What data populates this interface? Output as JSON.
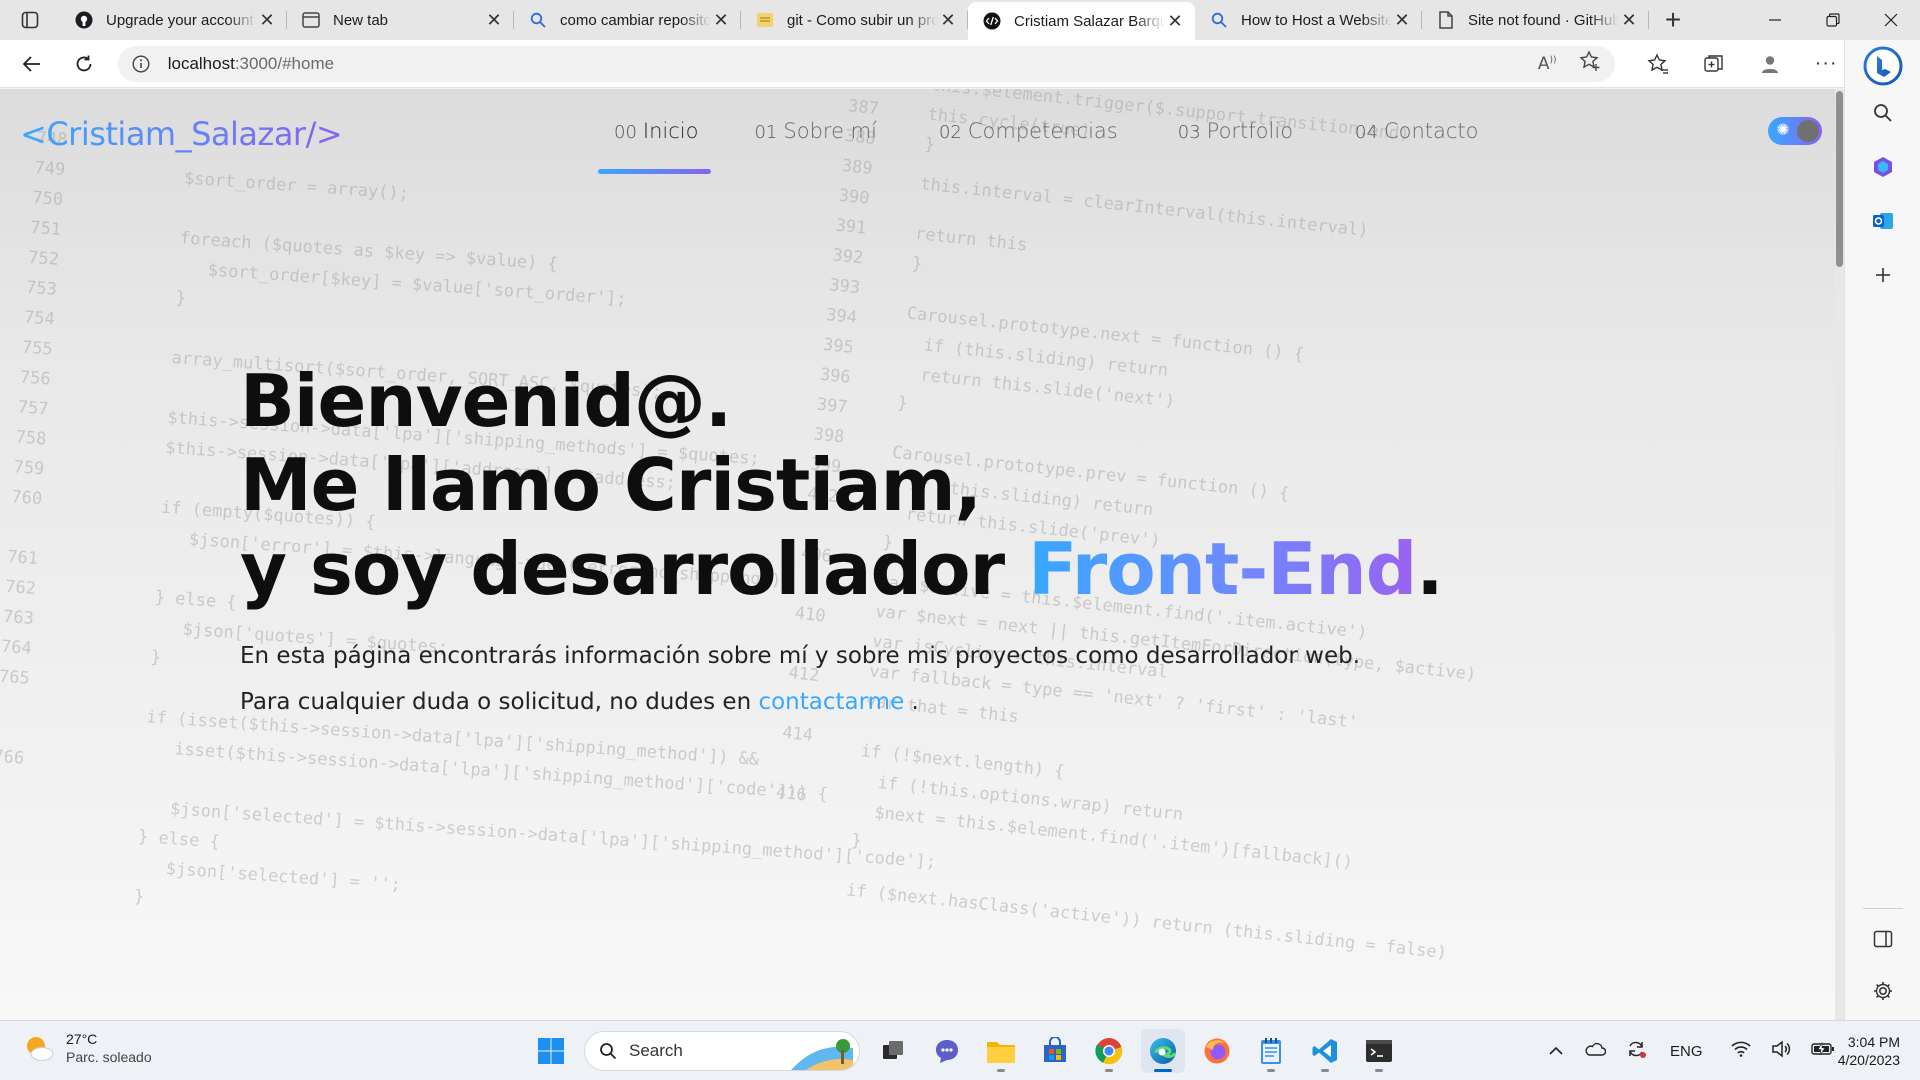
{
  "browser": {
    "tabs": [
      {
        "title": "Upgrade your account",
        "icon": "github-icon",
        "active": false
      },
      {
        "title": "New tab",
        "icon": "newtab-page-icon",
        "active": false
      },
      {
        "title": "como cambiar repositorio",
        "icon": "search-icon",
        "active": false
      },
      {
        "title": "git - Como subir un proyecto",
        "icon": "stackoverflow-icon",
        "active": false
      },
      {
        "title": "Cristiam Salazar Barquero",
        "icon": "site-logo-icon",
        "active": true
      },
      {
        "title": "How to Host a Website",
        "icon": "search-icon",
        "active": false
      },
      {
        "title": "Site not found · GitHub",
        "icon": "page-icon",
        "active": false
      }
    ],
    "address": {
      "host": "localhost",
      "path": ":3000/#home"
    }
  },
  "site": {
    "logo": "<Cristiam_Salazar/>",
    "nav": [
      {
        "num": "00",
        "label": "Inicio",
        "active": true
      },
      {
        "num": "01",
        "label": "Sobre mí",
        "active": false
      },
      {
        "num": "02",
        "label": "Competencias",
        "active": false
      },
      {
        "num": "03",
        "label": "Portfolio",
        "active": false
      },
      {
        "num": "04",
        "label": "Contacto",
        "active": false
      }
    ],
    "theme_toggle": {
      "icon": "sun-icon",
      "state": "light"
    },
    "hero": {
      "line1": "Bienvenid@.",
      "line2": "Me llamo Cristiam,",
      "line3_prefix": "y soy desarrollador ",
      "line3_highlight": "Front-End",
      "line3_suffix": ".",
      "paragraph1": "En esta página encontrarás información sobre mí y sobre mis proyectos como desarrollador web.",
      "paragraph2_prefix": "Para cualquier duda o solicitud, no dudes en ",
      "contact_link": "contactarme",
      "paragraph2_suffix": " ."
    },
    "accent_colors": {
      "start": "#38a8ff",
      "end": "#8a62f0"
    }
  },
  "taskbar": {
    "weather": {
      "temp": "27°C",
      "condition": "Parc. soleado"
    },
    "search_label": "Search",
    "apps": [
      "windows-start-icon",
      "search-box",
      "task-view-icon",
      "teams-chat-icon",
      "file-explorer-icon",
      "microsoft-store-icon",
      "chrome-icon",
      "edge-icon",
      "firefox-icon",
      "notepad-icon",
      "vscode-icon",
      "terminal-icon"
    ],
    "tray": {
      "language": "ENG"
    },
    "clock": {
      "time": "3:04 PM",
      "date": "4/20/2023"
    }
  }
}
